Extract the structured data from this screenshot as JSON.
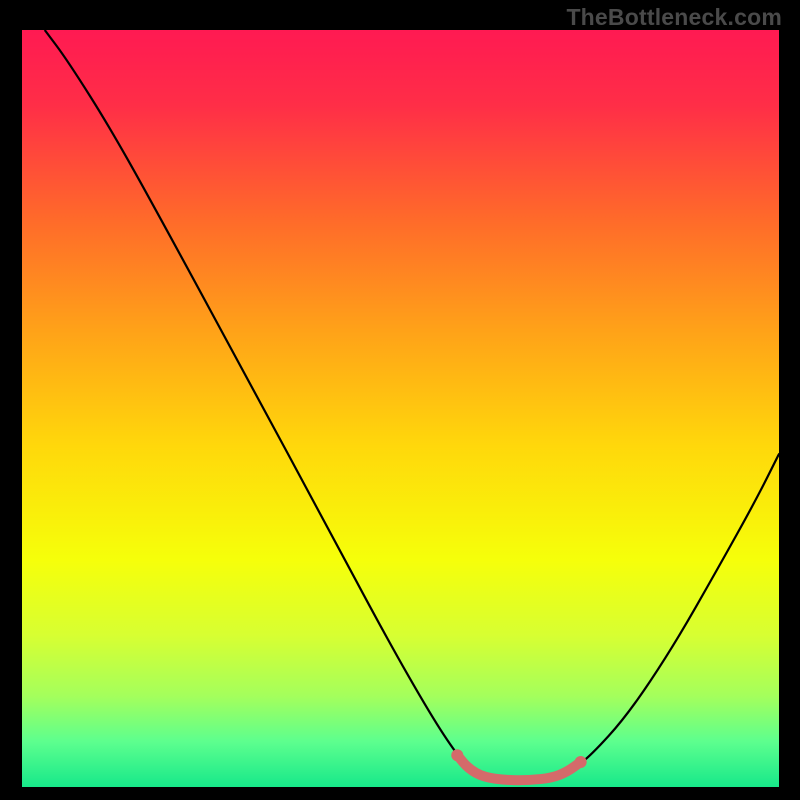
{
  "watermark": "TheBottleneck.com",
  "chart_data": {
    "type": "line",
    "title": "",
    "xlabel": "",
    "ylabel": "",
    "xlim": [
      0,
      100
    ],
    "ylim": [
      0,
      100
    ],
    "gradient_stops": [
      {
        "offset": 0.0,
        "color": "#ff1a52"
      },
      {
        "offset": 0.1,
        "color": "#ff2e47"
      },
      {
        "offset": 0.25,
        "color": "#ff6a2a"
      },
      {
        "offset": 0.4,
        "color": "#ffa318"
      },
      {
        "offset": 0.55,
        "color": "#ffd80b"
      },
      {
        "offset": 0.7,
        "color": "#f6ff0a"
      },
      {
        "offset": 0.8,
        "color": "#d7ff32"
      },
      {
        "offset": 0.88,
        "color": "#a4ff5c"
      },
      {
        "offset": 0.94,
        "color": "#5dff8e"
      },
      {
        "offset": 1.0,
        "color": "#17e88a"
      }
    ],
    "series": [
      {
        "name": "bottleneck-curve",
        "color": "#000000",
        "stroke_width": 2.2,
        "points": [
          {
            "x": 3.0,
            "y": 100.0
          },
          {
            "x": 6.0,
            "y": 96.0
          },
          {
            "x": 12.0,
            "y": 86.5
          },
          {
            "x": 20.0,
            "y": 72.0
          },
          {
            "x": 30.0,
            "y": 53.5
          },
          {
            "x": 40.0,
            "y": 35.0
          },
          {
            "x": 48.0,
            "y": 20.0
          },
          {
            "x": 54.0,
            "y": 9.5
          },
          {
            "x": 57.5,
            "y": 4.2
          },
          {
            "x": 59.5,
            "y": 2.0
          },
          {
            "x": 62.0,
            "y": 1.0
          },
          {
            "x": 66.0,
            "y": 0.8
          },
          {
            "x": 70.0,
            "y": 1.2
          },
          {
            "x": 72.5,
            "y": 2.2
          },
          {
            "x": 75.0,
            "y": 4.0
          },
          {
            "x": 80.0,
            "y": 9.5
          },
          {
            "x": 86.0,
            "y": 18.5
          },
          {
            "x": 92.0,
            "y": 29.0
          },
          {
            "x": 97.0,
            "y": 38.0
          },
          {
            "x": 100.0,
            "y": 44.0
          }
        ]
      },
      {
        "name": "recommended-range",
        "color": "#d46a6a",
        "stroke_width": 10,
        "linecap": "round",
        "points": [
          {
            "x": 57.5,
            "y": 4.2
          },
          {
            "x": 59.0,
            "y": 2.4
          },
          {
            "x": 61.0,
            "y": 1.3
          },
          {
            "x": 64.0,
            "y": 0.9
          },
          {
            "x": 67.0,
            "y": 0.9
          },
          {
            "x": 70.0,
            "y": 1.2
          },
          {
            "x": 72.0,
            "y": 2.0
          },
          {
            "x": 73.8,
            "y": 3.3
          }
        ]
      }
    ],
    "markers": [
      {
        "name": "left-endpoint",
        "x": 57.5,
        "y": 4.2,
        "r": 6,
        "color": "#d46a6a"
      },
      {
        "name": "right-endpoint",
        "x": 73.8,
        "y": 3.3,
        "r": 6,
        "color": "#d46a6a"
      }
    ]
  }
}
